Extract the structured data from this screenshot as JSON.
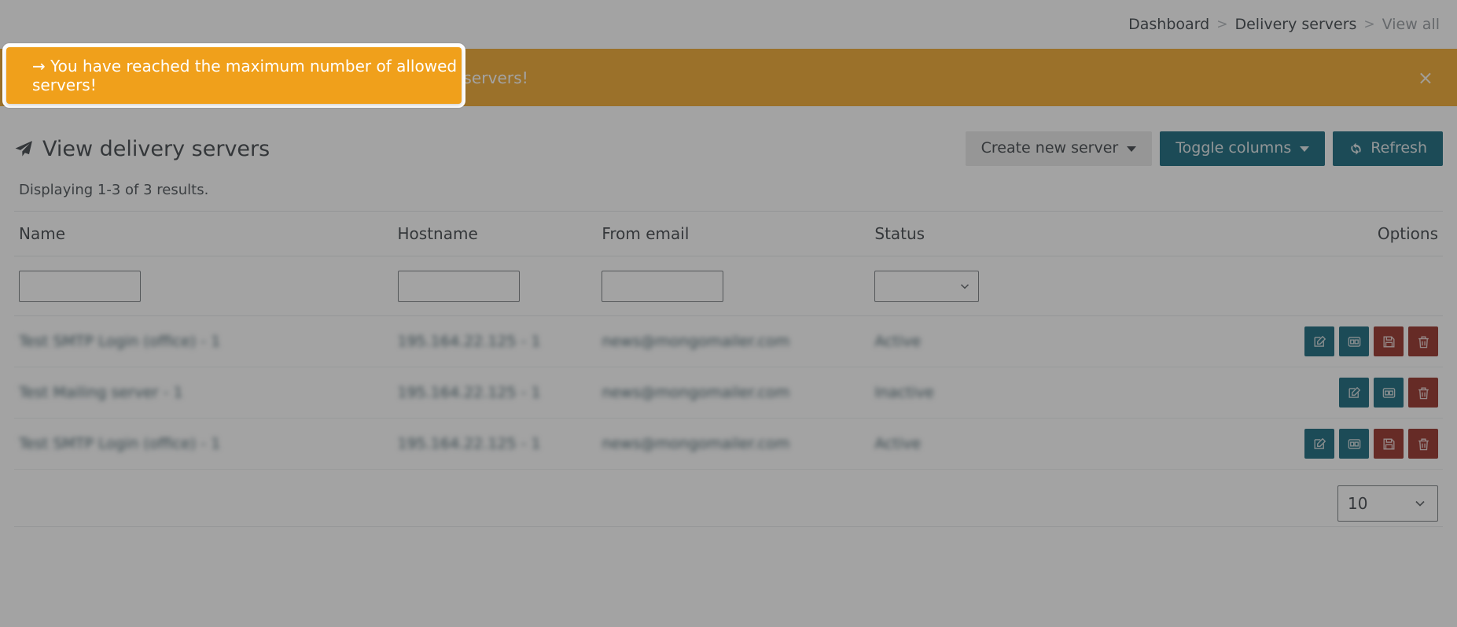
{
  "breadcrumb": {
    "items": [
      {
        "label": "Dashboard",
        "current": false
      },
      {
        "label": "Delivery servers",
        "current": false
      },
      {
        "label": "View all",
        "current": true
      }
    ],
    "separator": ">"
  },
  "alert": {
    "message": "→ You have reached the maximum number of allowed servers!",
    "close_label": "×",
    "background_color": "#f0a01b",
    "text_color": "#ffffff"
  },
  "header": {
    "title": "View delivery servers",
    "title_icon": "paper-plane-icon",
    "actions": {
      "create_label": "Create new server",
      "toggle_columns_label": "Toggle columns",
      "refresh_label": "Refresh",
      "refresh_icon": "refresh-icon"
    }
  },
  "results_text": "Displaying 1-3 of 3 results.",
  "table": {
    "columns": [
      "Name",
      "Hostname",
      "From email",
      "Status",
      "Options"
    ],
    "filters": {
      "name_value": "",
      "hostname_value": "",
      "from_email_value": "",
      "status_value": ""
    },
    "rows": [
      {
        "name": "Test SMTP Login (office) - 1",
        "hostname": "195.164.22.125 - 1",
        "from_email": "news@mongomailer.com",
        "status": "Active",
        "actions": [
          "edit-icon",
          "copy-icon",
          "save-icon",
          "delete-icon"
        ]
      },
      {
        "name": "Test Mailing server - 1",
        "hostname": "195.164.22.125 - 1",
        "from_email": "news@mongomailer.com",
        "status": "Inactive",
        "actions": [
          "edit-icon",
          "copy-icon",
          "delete-icon"
        ]
      },
      {
        "name": "Test SMTP Login (office) - 1",
        "hostname": "195.164.22.125 - 1",
        "from_email": "news@mongomailer.com",
        "status": "Active",
        "actions": [
          "edit-icon",
          "copy-icon",
          "save-icon",
          "delete-icon"
        ]
      }
    ]
  },
  "pagination": {
    "page_size": "10"
  },
  "colors": {
    "accent_teal": "#005a70",
    "danger_red": "#8d1d14",
    "warning_orange": "#f0a01b"
  }
}
